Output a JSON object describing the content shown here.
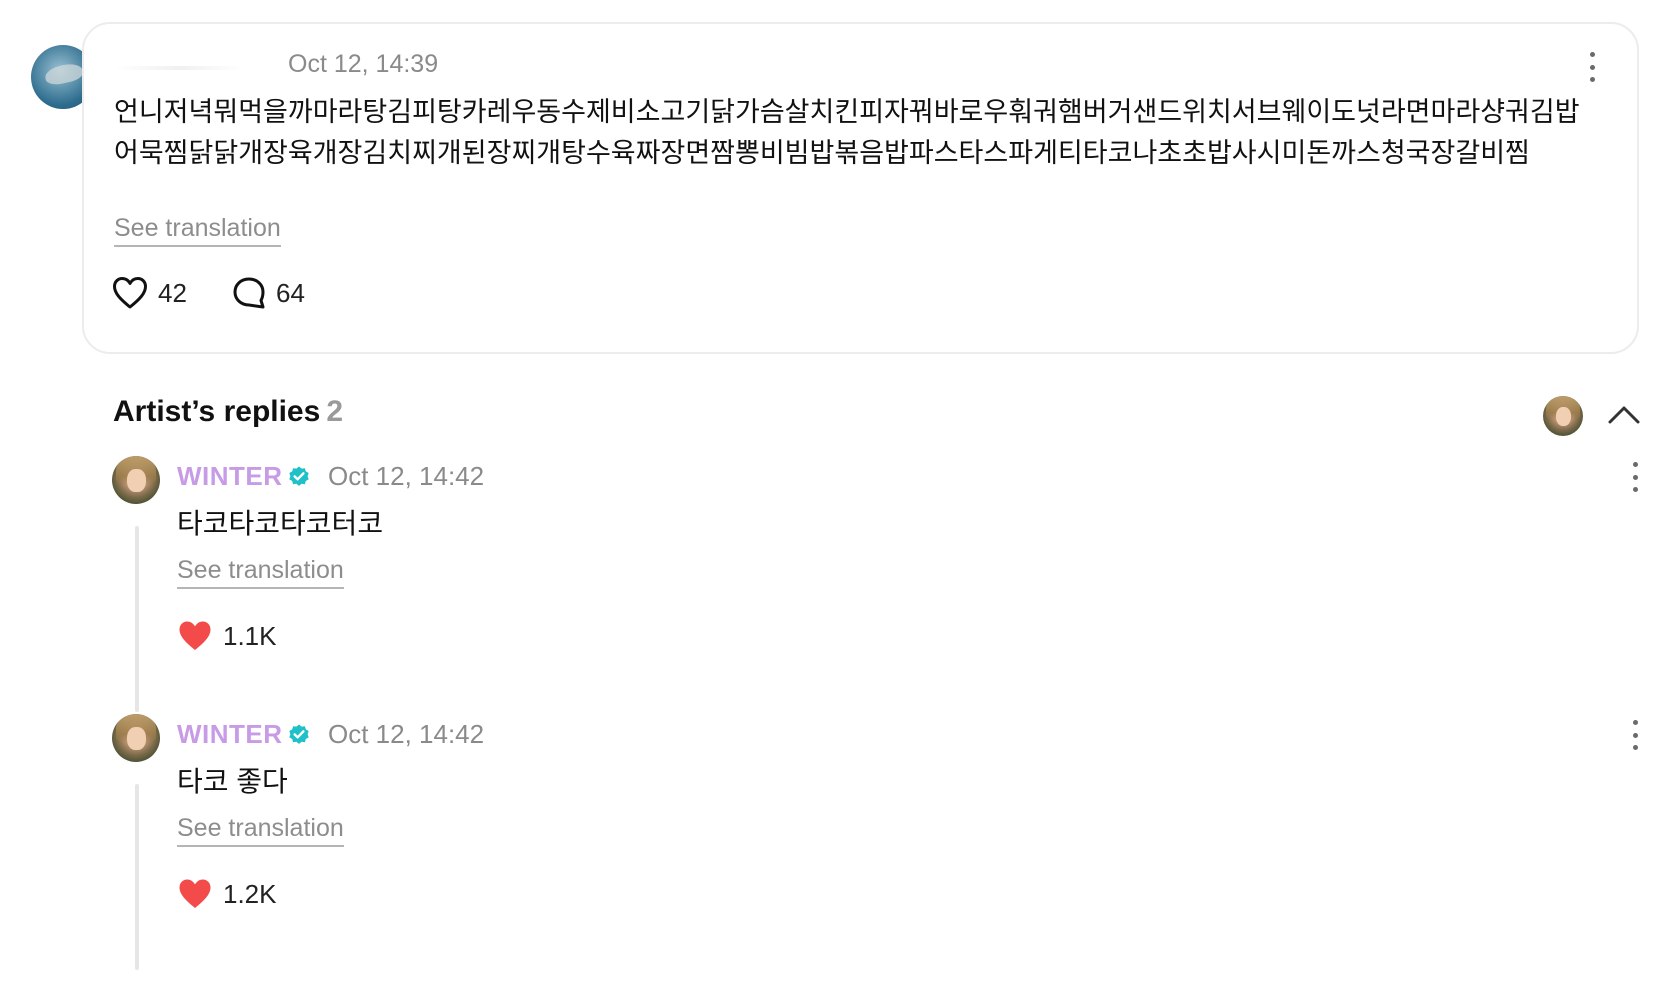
{
  "post": {
    "time": "Oct 12, 14:39",
    "body": "언니저녁뭐먹을까마라탕김피탕카레우동수제비소고기닭가슴살치킨피자꿔바로우훠궈햄버거샌드위치서브웨이도넛라면마라샹궈김밥어묵찜닭닭개장육개장김치찌개된장찌개탕수육짜장면짬뽕비빔밥볶음밥파스타스파게티타코나초초밥사시미돈까스청국장갈비찜",
    "see_translation": "See translation",
    "likes": "42",
    "comments": "64"
  },
  "replies_section": {
    "title": "Artist’s replies",
    "count": "2"
  },
  "replies": [
    {
      "author": "WINTER",
      "time": "Oct 12, 14:42",
      "body": "타코타코타코터코",
      "see_translation": "See translation",
      "likes": "1.1K"
    },
    {
      "author": "WINTER",
      "time": "Oct 12, 14:42",
      "body": "타코 좋다",
      "see_translation": "See translation",
      "likes": "1.2K"
    }
  ],
  "colors": {
    "artist_name": "#c79be6",
    "verified_badge": "#1fc0c7",
    "like_filled": "#f34a4a",
    "muted_text": "#8a8a8a",
    "card_border": "#ececec"
  },
  "icons": {
    "like_outline": "heart-outline-icon",
    "like_filled": "heart-filled-icon",
    "comment": "comment-bubble-icon",
    "more": "more-vertical-icon",
    "collapse": "chevron-up-icon",
    "verified": "verified-badge-icon"
  }
}
